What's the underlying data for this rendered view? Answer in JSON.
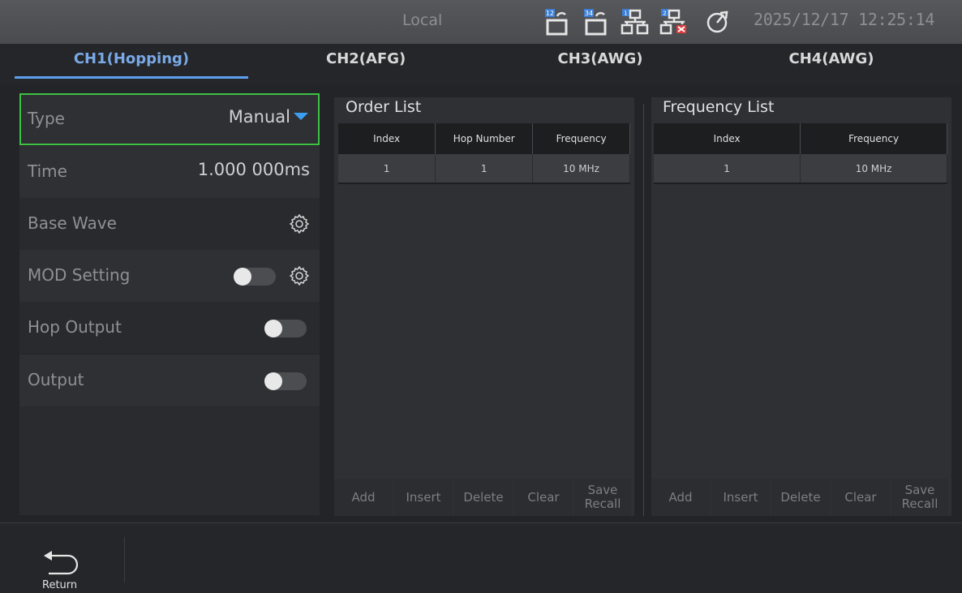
{
  "status": {
    "mode": "Local",
    "datetime": "2025/12/17 12:25:14",
    "icons": [
      "channel-12-icon",
      "channel-34-icon",
      "network-1-icon",
      "network-2-disconnected-icon",
      "clock-icon"
    ],
    "icon_labels": [
      "12",
      "34",
      "1",
      "2"
    ]
  },
  "tabs": [
    "CH1(Hopping)",
    "CH2(AFG)",
    "CH3(AWG)",
    "CH4(AWG)"
  ],
  "left": {
    "type_label": "Type",
    "type_value": "Manual",
    "time_label": "Time",
    "time_value": "1.000 000ms",
    "base_wave_label": "Base Wave",
    "mod_setting_label": "MOD Setting",
    "mod_setting_on": false,
    "hop_output_label": "Hop Output",
    "hop_output_on": false,
    "output_label": "Output",
    "output_on": false
  },
  "order_list": {
    "title": "Order List",
    "headers": [
      "Index",
      "Hop Number",
      "Frequency"
    ],
    "rows": [
      [
        "1",
        "1",
        "10 MHz"
      ]
    ],
    "buttons": [
      "Add",
      "Insert",
      "Delete",
      "Clear",
      "Save Recall"
    ]
  },
  "frequency_list": {
    "title": "Frequency List",
    "headers": [
      "Index",
      "Frequency"
    ],
    "rows": [
      [
        "1",
        "10 MHz"
      ]
    ],
    "buttons": [
      "Add",
      "Insert",
      "Delete",
      "Clear",
      "Save Recall"
    ]
  },
  "bottom": {
    "return_label": "Return"
  },
  "colors": {
    "accent": "#5ea0f0",
    "selected_border": "#3dc243",
    "disconnect": "#e23a3a"
  }
}
